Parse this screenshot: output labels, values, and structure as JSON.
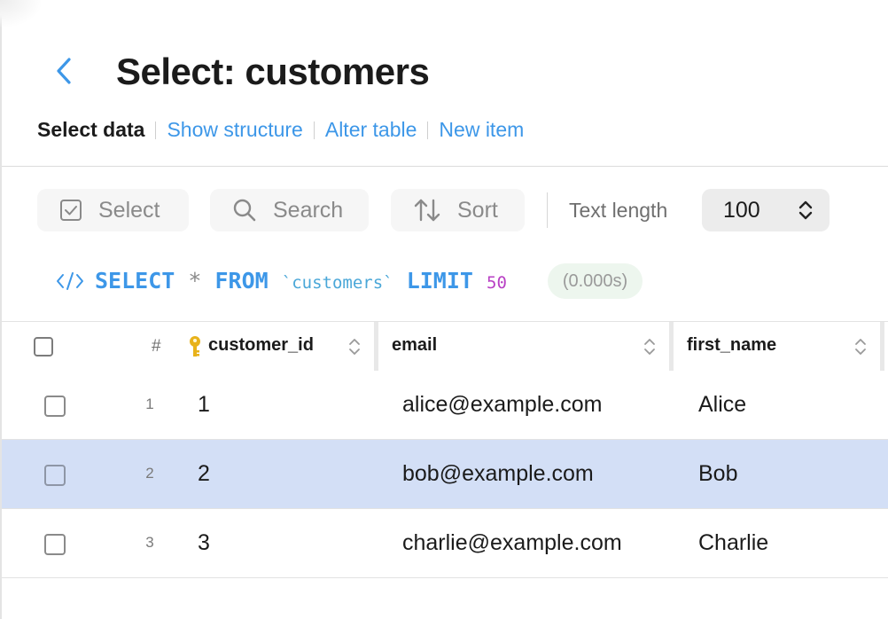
{
  "header": {
    "title": "Select: customers"
  },
  "nav": {
    "current": "Select data",
    "links": [
      "Show structure",
      "Alter table",
      "New item"
    ]
  },
  "toolbar": {
    "select_label": "Select",
    "search_label": "Search",
    "sort_label": "Sort",
    "text_length_label": "Text length",
    "text_length_value": "100"
  },
  "query": {
    "kw_select": "SELECT",
    "star": "*",
    "kw_from": "FROM",
    "table": "`customers`",
    "kw_limit": "LIMIT",
    "limit": "50",
    "timing": "(0.000s)"
  },
  "grid": {
    "row_number_header": "#",
    "columns": [
      "customer_id",
      "email",
      "first_name"
    ],
    "rows": [
      {
        "num": "1",
        "customer_id": "1",
        "email": "alice@example.com",
        "first_name": "Alice",
        "selected": false
      },
      {
        "num": "2",
        "customer_id": "2",
        "email": "bob@example.com",
        "first_name": "Bob",
        "selected": true
      },
      {
        "num": "3",
        "customer_id": "3",
        "email": "charlie@example.com",
        "first_name": "Charlie",
        "selected": false
      }
    ]
  },
  "colors": {
    "accent": "#3d97e8",
    "selected_row": "#d3dff6",
    "limit_number": "#b83fc4",
    "primary_key": "#e8b21a"
  },
  "icons": {
    "back": "chevron-left-icon",
    "select": "checkbox-icon",
    "search": "search-icon",
    "sort": "sort-arrows-icon",
    "text_length": "chevron-up-down-icon",
    "code": "code-icon",
    "primary_key": "key-icon",
    "column_sort": "chevron-up-down-icon"
  }
}
